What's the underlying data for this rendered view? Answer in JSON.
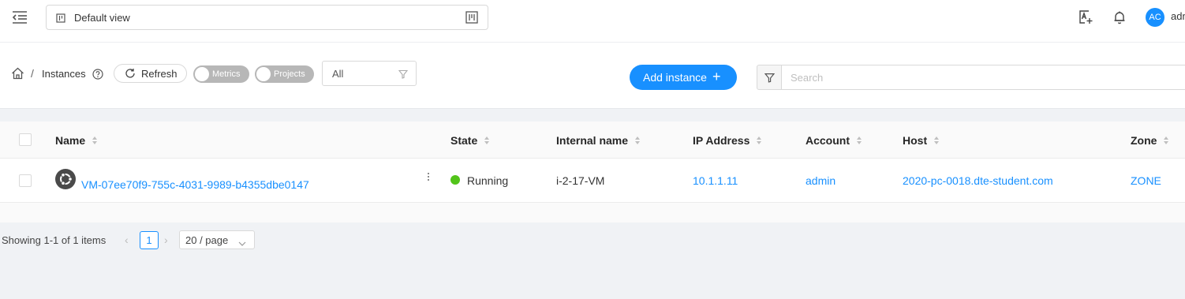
{
  "header": {
    "view_label": "Default view",
    "avatar_initials": "AC",
    "user_name": "admin"
  },
  "toolbar": {
    "breadcrumb_current": "Instances",
    "refresh_label": "Refresh",
    "metrics_label": "Metrics",
    "projects_label": "Projects",
    "filter_value": "All",
    "add_label": "Add instance",
    "search_placeholder": "Search"
  },
  "table": {
    "columns": [
      "Name",
      "State",
      "Internal name",
      "IP Address",
      "Account",
      "Host",
      "Zone"
    ],
    "rows": [
      {
        "name": "VM-07ee70f9-755c-4031-9989-b4355dbe0147",
        "state": "Running",
        "internal_name": "i-2-17-VM",
        "ip": "10.1.1.11",
        "account": "admin",
        "host": "2020-pc-0018.dte-student.com",
        "zone": "ZONE"
      }
    ]
  },
  "pagination": {
    "total_text": "Showing 1-1 of 1 items",
    "current_page": "1",
    "page_size": "20 / page"
  },
  "colors": {
    "primary": "#1890ff",
    "running": "#52c41a"
  },
  "icons": [
    "menu-fold-icon",
    "board-icon",
    "translate-icon",
    "bell-icon",
    "home-icon",
    "question-circle-icon",
    "reload-icon",
    "filter-icon",
    "plus-icon",
    "ubuntu-icon",
    "more-vertical-icon",
    "chevron-left-icon",
    "chevron-right-icon",
    "chevron-down-icon"
  ]
}
